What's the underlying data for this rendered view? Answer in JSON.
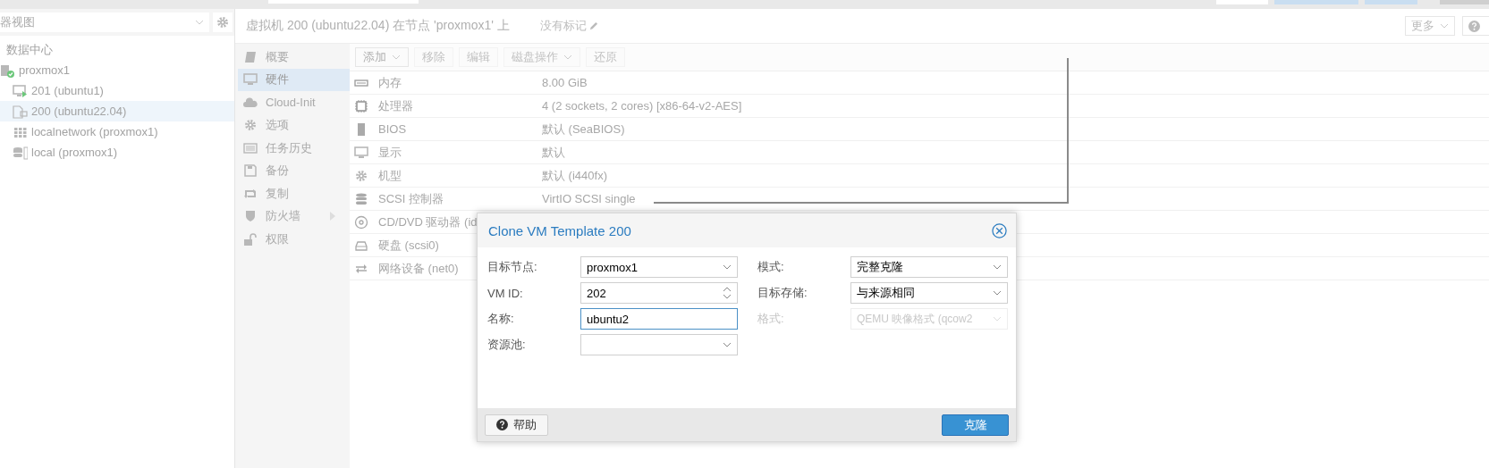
{
  "tree_panel": {
    "view_selector": {
      "value": "器视图"
    },
    "items": [
      {
        "label": "数据中心",
        "kind": "datacenter",
        "selected": false,
        "children": [
          {
            "label": "proxmox1",
            "kind": "node",
            "selected": false,
            "children": [
              {
                "label": "201 (ubuntu1)",
                "kind": "vm-running",
                "selected": false
              },
              {
                "label": "200 (ubuntu22.04)",
                "kind": "template",
                "selected": true
              },
              {
                "label": "localnetwork (proxmox1)",
                "kind": "network",
                "selected": false
              },
              {
                "label": "local (proxmox1)",
                "kind": "storage",
                "selected": false
              }
            ]
          }
        ]
      }
    ]
  },
  "header": {
    "title": "虚拟机 200 (ubuntu22.04) 在节点 'proxmox1' 上",
    "tags": "没有标记",
    "more_button": "更多"
  },
  "nav": [
    {
      "label": "概要",
      "selected": false,
      "submenu": false
    },
    {
      "label": "硬件",
      "selected": true,
      "submenu": false
    },
    {
      "label": "Cloud-Init",
      "selected": false,
      "submenu": false
    },
    {
      "label": "选项",
      "selected": false,
      "submenu": false
    },
    {
      "label": "任务历史",
      "selected": false,
      "submenu": false
    },
    {
      "label": "备份",
      "selected": false,
      "submenu": false
    },
    {
      "label": "复制",
      "selected": false,
      "submenu": false
    },
    {
      "label": "防火墙",
      "selected": false,
      "submenu": true
    },
    {
      "label": "权限",
      "selected": false,
      "submenu": false
    }
  ],
  "toolbar": [
    {
      "label": "添加",
      "dropdown": true
    },
    {
      "label": "移除",
      "dropdown": false
    },
    {
      "label": "编辑",
      "dropdown": false
    },
    {
      "label": "磁盘操作",
      "dropdown": true
    },
    {
      "label": "还原",
      "dropdown": false
    }
  ],
  "hardware": [
    {
      "name": "内存",
      "value": "8.00 GiB"
    },
    {
      "name": "处理器",
      "value": "4 (2 sockets, 2 cores) [x86-64-v2-AES]"
    },
    {
      "name": "BIOS",
      "value": "默认 (SeaBIOS)"
    },
    {
      "name": "显示",
      "value": "默认"
    },
    {
      "name": "机型",
      "value": "默认 (i440fx)"
    },
    {
      "name": "SCSI 控制器",
      "value": "VirtIO SCSI single"
    },
    {
      "name": "CD/DVD 驱动器 (id"
    },
    {
      "name": "硬盘 (scsi0)"
    },
    {
      "name": "网络设备 (net0)"
    }
  ],
  "dialog": {
    "title": "Clone VM Template 200",
    "left_fields": [
      {
        "label": "目标节点:",
        "value": "proxmox1",
        "kind": "select",
        "focused": false,
        "disabled": false
      },
      {
        "label": "VM ID:",
        "value": "202",
        "kind": "spinner",
        "focused": false,
        "disabled": false
      },
      {
        "label": "名称:",
        "value": "ubuntu2",
        "kind": "text",
        "focused": true,
        "disabled": false
      },
      {
        "label": "资源池:",
        "kind": "select",
        "focused": false,
        "disabled": false
      }
    ],
    "right_fields": [
      {
        "label": "模式:",
        "value": "完整克隆",
        "kind": "select",
        "focused": false,
        "disabled": false
      },
      {
        "label": "目标存储:",
        "value": "与来源相同",
        "kind": "select",
        "focused": false,
        "disabled": false
      },
      {
        "label": "格式:",
        "value": "QEMU 映像格式 (qcow2",
        "kind": "select",
        "focused": false,
        "disabled": true
      }
    ],
    "help_button": "帮助",
    "clone_button": "克隆"
  }
}
